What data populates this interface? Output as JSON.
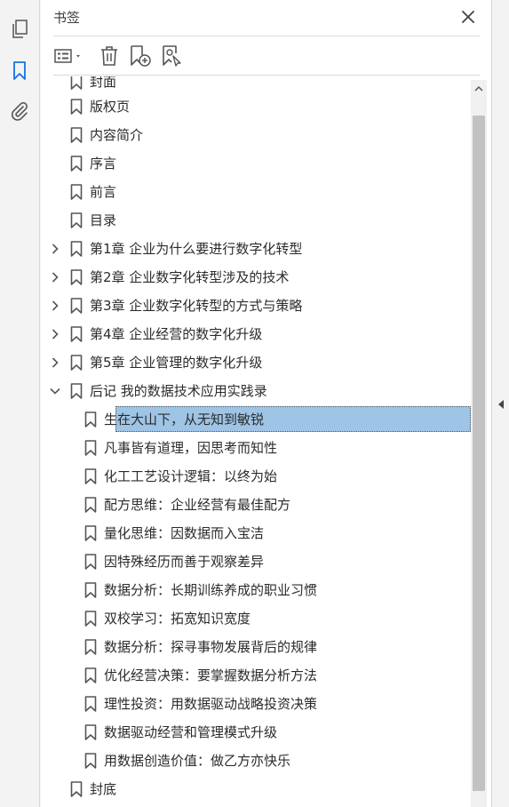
{
  "sidebar_rail": {
    "icons": [
      {
        "name": "pages-icon"
      },
      {
        "name": "bookmarks-icon",
        "active": true
      },
      {
        "name": "attachments-icon"
      }
    ]
  },
  "panel": {
    "title": "书签",
    "close_icon": "close-icon"
  },
  "toolbar": {
    "buttons": [
      {
        "name": "options-menu",
        "icon": "list-options-icon"
      },
      {
        "name": "delete-bookmark",
        "icon": "trash-icon"
      },
      {
        "name": "new-bookmark",
        "icon": "add-bookmark-icon"
      },
      {
        "name": "bookmark-from-selection",
        "icon": "bookmark-search-icon"
      }
    ]
  },
  "bookmarks": {
    "partial_top": "封面",
    "items": [
      {
        "label": "版权页"
      },
      {
        "label": "内容简介"
      },
      {
        "label": "序言"
      },
      {
        "label": "前言"
      },
      {
        "label": "目录"
      },
      {
        "label": "第1章 企业为什么要进行数字化转型",
        "expandable": true
      },
      {
        "label": "第2章 企业数字化转型涉及的技术",
        "expandable": true
      },
      {
        "label": "第3章 企业数字化转型的方式与策略",
        "expandable": true
      },
      {
        "label": "第4章 企业经营的数字化升级",
        "expandable": true
      },
      {
        "label": "第5章 企业管理的数字化升级",
        "expandable": true
      },
      {
        "label": "后记  我的数据技术应用实践录",
        "expanded": true
      },
      {
        "label": "生在大山下，从无知到敏锐",
        "child": true,
        "selected": true
      },
      {
        "label": "凡事皆有道理，因思考而知性",
        "child": true
      },
      {
        "label": "化工工艺设计逻辑：以终为始",
        "child": true
      },
      {
        "label": "配方思维：企业经营有最佳配方",
        "child": true
      },
      {
        "label": "量化思维：因数据而入宝洁",
        "child": true
      },
      {
        "label": "因特殊经历而善于观察差异",
        "child": true
      },
      {
        "label": "数据分析：长期训练养成的职业习惯",
        "child": true
      },
      {
        "label": "双校学习：拓宽知识宽度",
        "child": true
      },
      {
        "label": "数据分析：探寻事物发展背后的规律",
        "child": true
      },
      {
        "label": "优化经营决策：要掌握数据分析方法",
        "child": true
      },
      {
        "label": "理性投资：用数据驱动战略投资决策",
        "child": true
      },
      {
        "label": "数据驱动经营和管理模式升级",
        "child": true
      },
      {
        "label": "用数据创造价值：做乙方亦快乐",
        "child": true
      },
      {
        "label": "封底"
      }
    ]
  },
  "colors": {
    "selection": "#9ec4e6",
    "active_icon": "#1473e6",
    "icon": "#555555"
  }
}
